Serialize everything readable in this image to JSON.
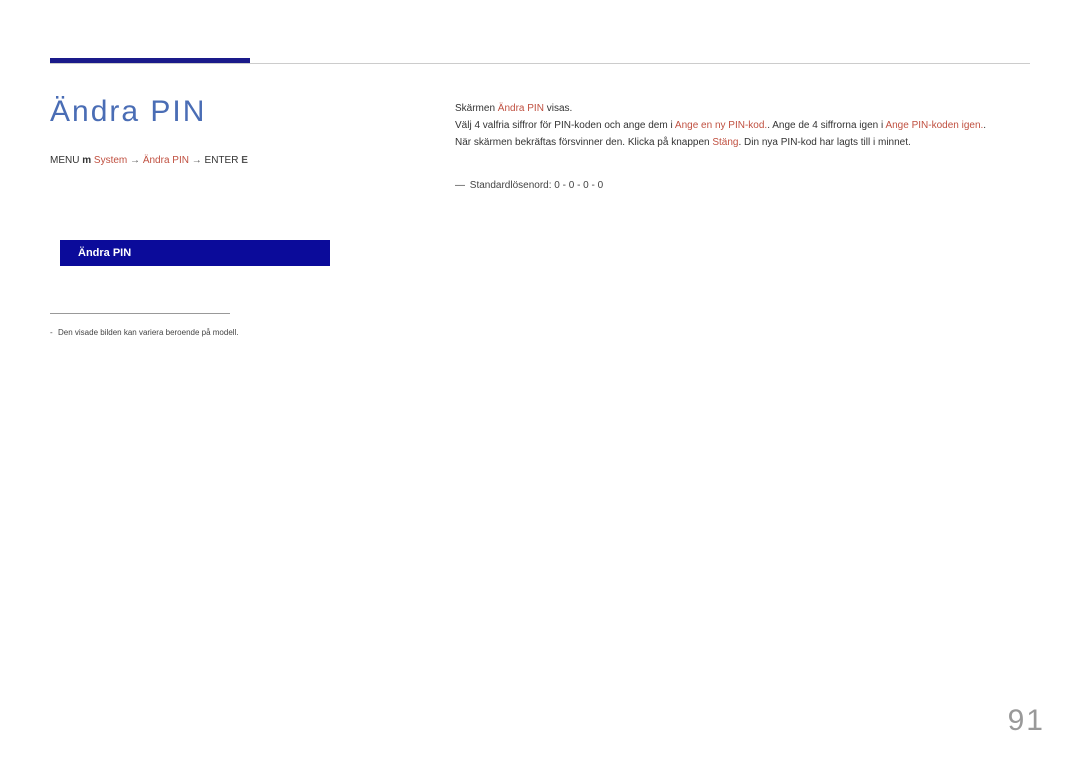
{
  "page_title": "Ändra  PIN",
  "breadcrumb": {
    "menu": "MENU",
    "menu_icon": "m",
    "system": "System",
    "arrow": "→",
    "change_pin": "Ändra PIN",
    "arrow2": "→",
    "enter": "ENTER",
    "enter_icon": "E"
  },
  "menu_box_label": "Ändra PIN",
  "footnote": "Den visade bilden kan variera beroende på modell.",
  "body": {
    "line1_prefix": "Skärmen ",
    "line1_hl": "Ändra PIN",
    "line1_suffix": " visas.",
    "line2_prefix": "Välj 4 valfria siffror för PIN-koden och ange dem i ",
    "line2_hl1": "Ange en ny PIN-kod.",
    "line2_mid": ". Ange de 4 siffrorna igen i ",
    "line2_hl2": "Ange PIN-koden igen.",
    "line2_suffix": ".",
    "line3_prefix": "När skärmen bekräftas försvinner den. Klicka på knappen ",
    "line3_hl": "Stäng",
    "line3_suffix": ". Din nya PIN-kod har lagts till i minnet."
  },
  "pin_default_label": "Standardlösenord: 0 - 0 - 0 - 0",
  "page_number": "91"
}
